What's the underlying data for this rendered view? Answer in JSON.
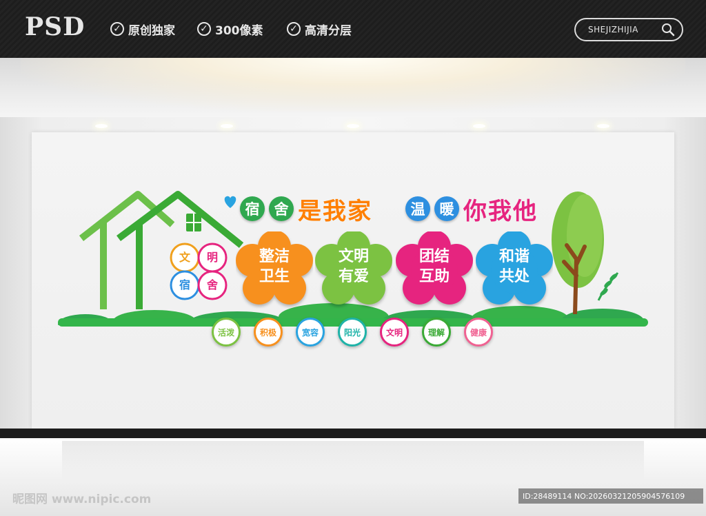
{
  "banner": {
    "logo": "PSD",
    "features": [
      {
        "icon": "check-circle-icon",
        "label": "原创独家"
      },
      {
        "icon": "check-circle-icon",
        "label": "300像素"
      },
      {
        "icon": "check-circle-icon",
        "label": "高清分层"
      }
    ],
    "search_text": "SHEJIZHIJIA"
  },
  "artwork": {
    "title_circles": [
      {
        "char": "宿",
        "color": "#2fa84f"
      },
      {
        "char": "舍",
        "color": "#2fa84f"
      }
    ],
    "title_part1": "是我家",
    "title_part1_color": "#ff7f00",
    "title_circles2": [
      {
        "char": "温",
        "color": "#2d8fe0"
      },
      {
        "char": "暖",
        "color": "#2d8fe0"
      }
    ],
    "title_part2": "你我他",
    "title_part2_color": "#e6247f",
    "house_mini": [
      {
        "char": "文",
        "color": "#f0a01d"
      },
      {
        "char": "明",
        "color": "#e6247f"
      },
      {
        "char": "宿",
        "color": "#2d8fe0"
      },
      {
        "char": "舍",
        "color": "#e6247f"
      }
    ],
    "flowers": [
      {
        "line1": "整洁",
        "line2": "卫生",
        "color": "#f7901e"
      },
      {
        "line1": "文明",
        "line2": "有爱",
        "color": "#7cc242"
      },
      {
        "line1": "团结",
        "line2": "互助",
        "color": "#e6247f"
      },
      {
        "line1": "和谐",
        "line2": "共处",
        "color": "#29a3e0"
      }
    ],
    "badges": [
      {
        "label": "活泼",
        "color": "#7cc242"
      },
      {
        "label": "积极",
        "color": "#f7901e"
      },
      {
        "label": "宽容",
        "color": "#29a3e0"
      },
      {
        "label": "阳光",
        "color": "#1fb3a8"
      },
      {
        "label": "文明",
        "color": "#e6247f"
      },
      {
        "label": "理解",
        "color": "#3aaa35"
      },
      {
        "label": "健康",
        "color": "#f06292"
      }
    ]
  },
  "footer": {
    "watermark": "昵图网 www.nipic.com",
    "id_text": "ID:28489114 NO:20260321205904576109"
  }
}
